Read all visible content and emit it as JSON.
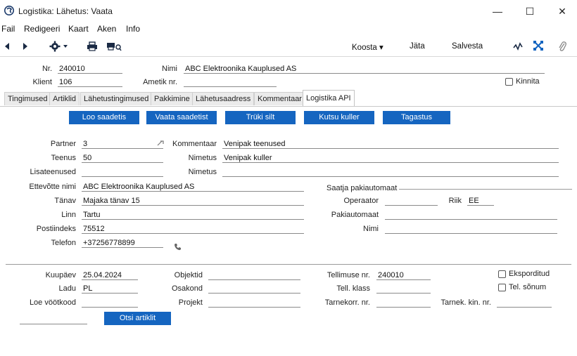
{
  "window": {
    "title": "Logistika: Lähetus: Vaata",
    "minimize": "—",
    "maximize": "☐",
    "close": "✕"
  },
  "menu": [
    "Fail",
    "Redigeeri",
    "Kaart",
    "Aken",
    "Info"
  ],
  "toolbar": {
    "koosta": "Koosta ▾",
    "jata": "Jäta",
    "salvesta": "Salvesta"
  },
  "header": {
    "nr_label": "Nr.",
    "nr_value": "240010",
    "nimi_label": "Nimi",
    "nimi_value": "ABC Elektroonika Kauplused AS",
    "klient_label": "Klient",
    "klient_value": "106",
    "ametik_label": "Ametik nr.",
    "ametik_value": "",
    "kinnita_label": "Kinnita"
  },
  "tabs": [
    "Tingimused",
    "Artiklid",
    "Lähetustingimused",
    "Pakkimine",
    "Lähetusaadress",
    "Kommentaar",
    "Logistika API"
  ],
  "actions": [
    "Loo saadetis",
    "Vaata saadetist",
    "Trüki silt",
    "Kutsu kuller",
    "Tagastus"
  ],
  "form": {
    "partner_label": "Partner",
    "partner_value": "3",
    "kommentaar_label": "Kommentaar",
    "kommentaar_value": "Venipak teenused",
    "teenus_label": "Teenus",
    "teenus_value": "50",
    "nimetus_label": "Nimetus",
    "nimetus_value": "Venipak kuller",
    "lisateenused_label": "Lisateenused",
    "lisateenused_value": "",
    "nimetus2_label": "Nimetus",
    "nimetus2_value": "",
    "ettevotte_label": "Ettevõtte nimi",
    "ettevotte_value": "ABC Elektroonika Kauplused AS",
    "tanav_label": "Tänav",
    "tanav_value": "Majaka tänav 15",
    "linn_label": "Linn",
    "linn_value": "Tartu",
    "postiindeks_label": "Postiindeks",
    "postiindeks_value": "75512",
    "telefon_label": "Telefon",
    "telefon_value": "+37256778899",
    "saatja_label": "Saatja pakiautomaat",
    "operaator_label": "Operaator",
    "operaator_value": "",
    "riik_label": "Riik",
    "riik_value": "EE",
    "pakiautomaat_label": "Pakiautomaat",
    "pakiautomaat_value": "",
    "nimi_label": "Nimi",
    "nimi_value": ""
  },
  "bottom": {
    "kuupaev_label": "Kuupäev",
    "kuupaev_value": "25.04.2024",
    "objektid_label": "Objektid",
    "objektid_value": "",
    "tellimuse_label": "Tellimuse nr.",
    "tellimuse_value": "240010",
    "eksporditud_label": "Eksporditud",
    "ladu_label": "Ladu",
    "ladu_value": "PL",
    "osakond_label": "Osakond",
    "osakond_value": "",
    "tellklass_label": "Tell. klass",
    "tellklass_value": "",
    "telsonum_label": "Tel. sõnum",
    "loe_label": "Loe vöötkood",
    "loe_value": "",
    "projekt_label": "Projekt",
    "projekt_value": "",
    "tarnekorr_label": "Tarnekorr. nr.",
    "tarnekorr_value": "",
    "tarnekkin_label": "Tarnek. kin. nr.",
    "tarnekkin_value": "",
    "otsi_button": "Otsi artiklit"
  }
}
